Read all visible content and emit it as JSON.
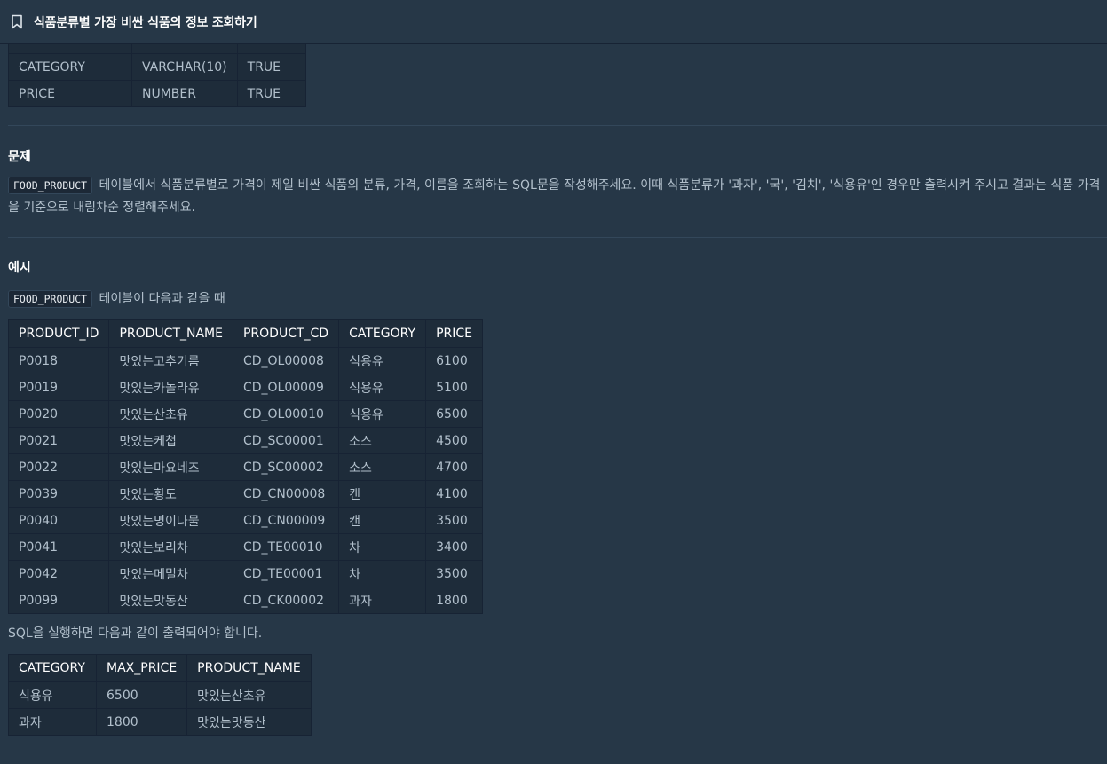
{
  "header": {
    "title": "식품분류별 가장 비싼 식품의 정보 조회하기",
    "bookmark_icon": "bookmark-icon"
  },
  "schema_table": {
    "rows": [
      [
        "CATEGORY",
        "VARCHAR(10)",
        "TRUE"
      ],
      [
        "PRICE",
        "NUMBER",
        "TRUE"
      ]
    ]
  },
  "problem": {
    "title": "문제",
    "table_code": "FOOD_PRODUCT",
    "text_line1": "테이블에서 식품분류별로 가격이 제일 비싼 식품의 분류, 가격, 이름을 조회하는 SQL문을 작성해주세요. 이때 식품분류가 '과자', '국', '김치', '식용유'인 경우만 출력시켜 주시고 결과는 식품 가격",
    "text_line2": "을 기준으로 내림차순 정렬해주세요."
  },
  "example": {
    "title": "예시",
    "table_code": "FOOD_PRODUCT",
    "intro_text": "테이블이 다음과 같을 때",
    "table": {
      "headers": [
        "PRODUCT_ID",
        "PRODUCT_NAME",
        "PRODUCT_CD",
        "CATEGORY",
        "PRICE"
      ],
      "rows": [
        [
          "P0018",
          "맛있는고추기름",
          "CD_OL00008",
          "식용유",
          "6100"
        ],
        [
          "P0019",
          "맛있는카놀라유",
          "CD_OL00009",
          "식용유",
          "5100"
        ],
        [
          "P0020",
          "맛있는산초유",
          "CD_OL00010",
          "식용유",
          "6500"
        ],
        [
          "P0021",
          "맛있는케첩",
          "CD_SC00001",
          "소스",
          "4500"
        ],
        [
          "P0022",
          "맛있는마요네즈",
          "CD_SC00002",
          "소스",
          "4700"
        ],
        [
          "P0039",
          "맛있는황도",
          "CD_CN00008",
          "캔",
          "4100"
        ],
        [
          "P0040",
          "맛있는명이나물",
          "CD_CN00009",
          "캔",
          "3500"
        ],
        [
          "P0041",
          "맛있는보리차",
          "CD_TE00010",
          "차",
          "3400"
        ],
        [
          "P0042",
          "맛있는메밀차",
          "CD_TE00001",
          "차",
          "3500"
        ],
        [
          "P0099",
          "맛있는맛동산",
          "CD_CK00002",
          "과자",
          "1800"
        ]
      ]
    },
    "result_text": "SQL을 실행하면 다음과 같이 출력되어야 합니다.",
    "result_table": {
      "headers": [
        "CATEGORY",
        "MAX_PRICE",
        "PRODUCT_NAME"
      ],
      "rows": [
        [
          "식용유",
          "6500",
          "맛있는산초유"
        ],
        [
          "과자",
          "1800",
          "맛있는맛동산"
        ]
      ]
    }
  }
}
